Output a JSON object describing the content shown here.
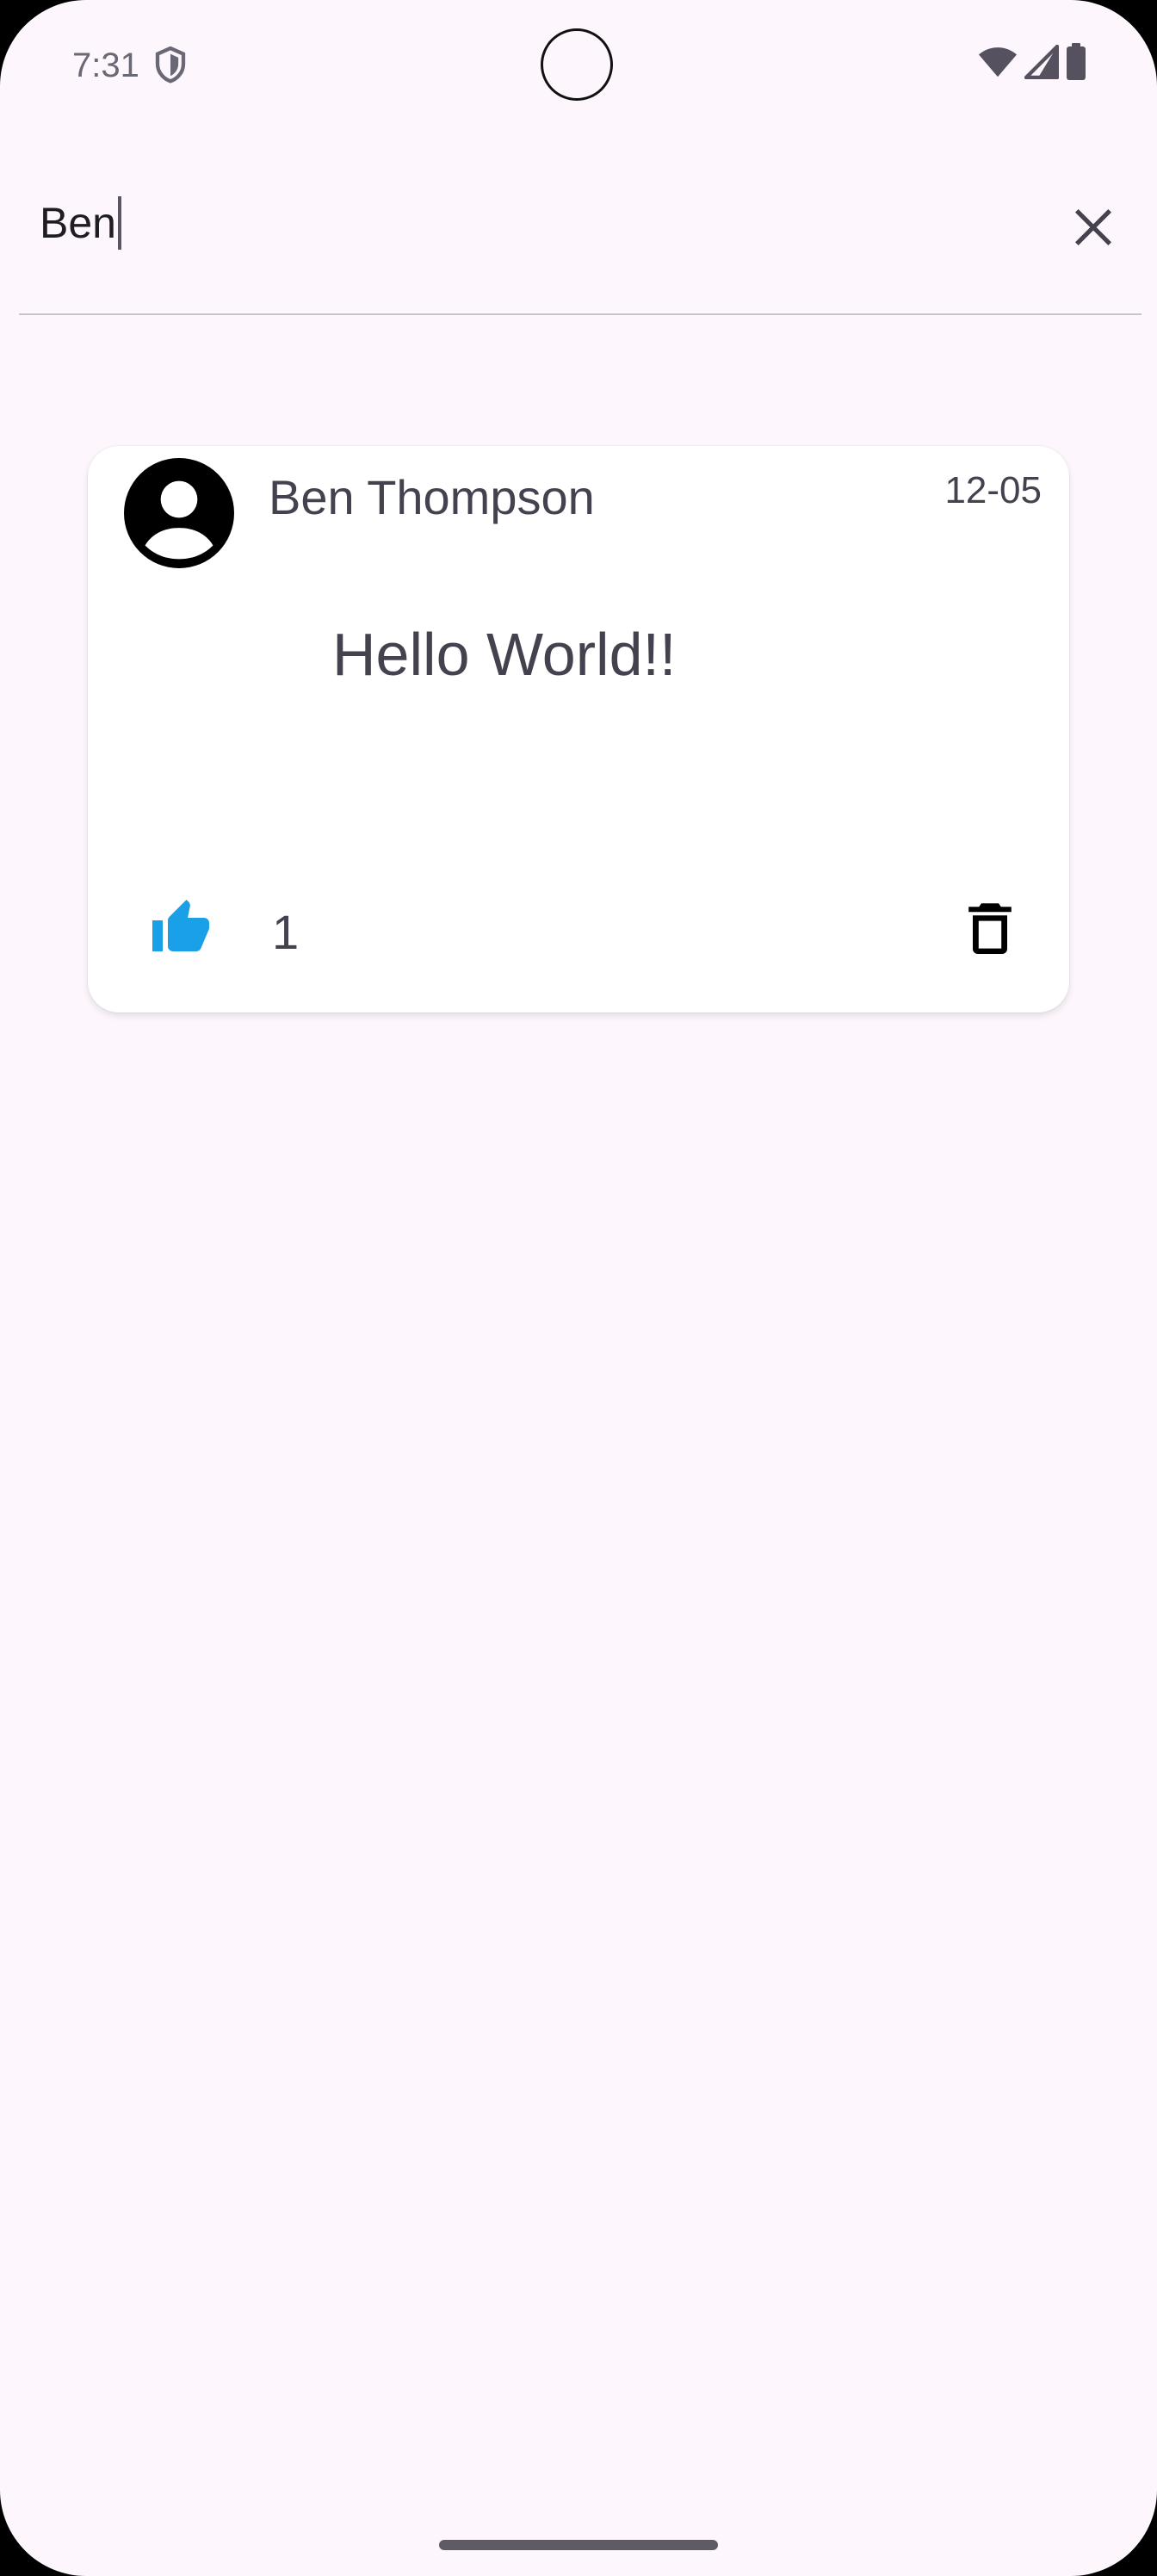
{
  "status_bar": {
    "time": "7:31",
    "icons": [
      "shield-icon",
      "wifi-icon",
      "cellular-signal-icon",
      "battery-icon"
    ]
  },
  "search": {
    "value": "Ben",
    "clear_icon": "close-icon"
  },
  "posts": [
    {
      "author": "Ben Thompson",
      "date": "12-05",
      "body": "Hello World!!",
      "likes": "1",
      "liked": true,
      "avatar_icon": "account-circle-icon",
      "like_icon": "thumb-up-icon",
      "delete_icon": "delete-icon"
    }
  ],
  "colors": {
    "background": "#fdf6fd",
    "card": "#ffffff",
    "like_active": "#1aa0e6",
    "text": "#45424f"
  }
}
